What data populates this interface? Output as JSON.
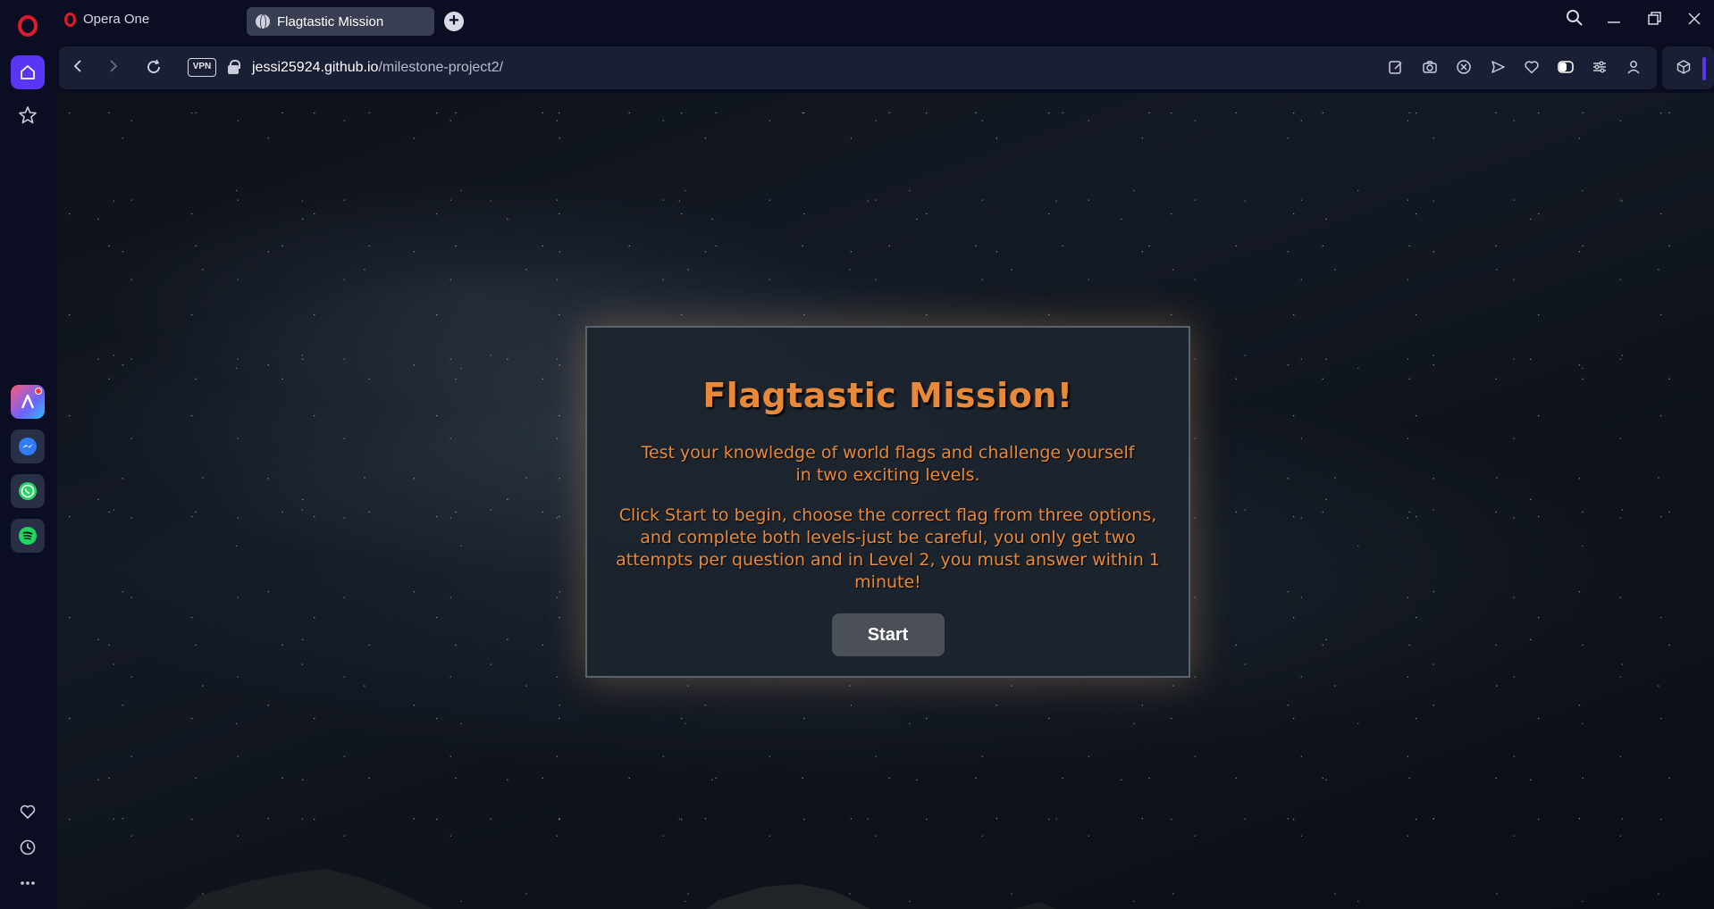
{
  "browser": {
    "brand_label": "Opera One",
    "tab_title": "Flagtastic Mission",
    "vpn_label": "VPN",
    "url_host": "jessi25924.github.io",
    "url_path": "/milestone-project2/",
    "accent_color": "#5b35f5"
  },
  "sidebar": {
    "items": [
      "home-icon",
      "bookmarks-icon",
      "aria-icon",
      "messenger-icon",
      "whatsapp-icon",
      "spotify-icon",
      "heart-icon",
      "history-icon",
      "more-icon"
    ]
  },
  "toolbar_icons": [
    "edit-icon",
    "camera-icon",
    "adblock-icon",
    "send-icon",
    "heart-icon",
    "easy-setup-icon",
    "settings-icon",
    "account-icon",
    "extensions-icon"
  ],
  "game": {
    "title": "Flagtastic Mission!",
    "intro": "Test your knowledge of world flags and challenge yourself in two exciting levels.",
    "instructions": "Click Start to begin, choose the correct flag from three options, and complete both levels-just be careful, you only get two attempts per question and in Level 2, you must answer within 1 minute!",
    "start_label": "Start",
    "title_color": "#e8893a"
  }
}
